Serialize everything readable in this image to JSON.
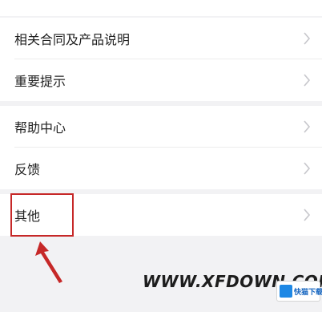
{
  "menu": {
    "groups": [
      {
        "items": [
          {
            "label": "相关合同及产品说明",
            "icon": "chevron-right-icon"
          },
          {
            "label": "重要提示",
            "icon": "chevron-right-icon"
          }
        ]
      },
      {
        "items": [
          {
            "label": "帮助中心",
            "icon": "chevron-right-icon"
          },
          {
            "label": "反馈",
            "icon": "chevron-right-icon"
          }
        ]
      },
      {
        "items": [
          {
            "label": "其他",
            "icon": "chevron-right-icon"
          }
        ]
      }
    ]
  },
  "annotation": {
    "highlight_color": "#c62828",
    "highlighted_item": "其他"
  },
  "watermark": {
    "url_text": "WWW.XFDOWN.COM",
    "logo_text": "快猫下载网"
  },
  "colors": {
    "background": "#f2f2f4",
    "row_background": "#ffffff",
    "text": "#222222",
    "chevron": "#c7c7cc"
  }
}
